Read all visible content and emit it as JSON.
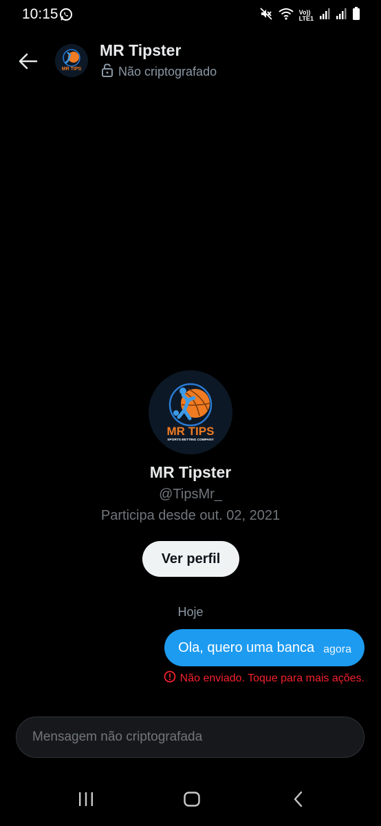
{
  "status_bar": {
    "time": "10:15",
    "volte_top": "Vo))",
    "volte_bottom": "LTE1",
    "icons": [
      "whatsapp-icon",
      "mute-icon",
      "wifi-icon",
      "signal-icon",
      "signal-icon",
      "battery-icon"
    ]
  },
  "header": {
    "name": "MR Tipster",
    "encryption_status": "Não criptografado"
  },
  "profile": {
    "name": "MR Tipster",
    "handle": "@TipsMr_",
    "joined": "Participa desde out. 02, 2021",
    "view_profile_label": "Ver perfil",
    "logo_text": "MR TIPS",
    "logo_subtext": "SPORTS BETTING COMPANY"
  },
  "conversation": {
    "date_separator": "Hoje",
    "messages": [
      {
        "text": "Ola, quero uma banca",
        "time": "agora",
        "error": "Não enviado. Toque para mais ações."
      }
    ]
  },
  "composer": {
    "placeholder": "Mensagem não criptografada"
  },
  "colors": {
    "background": "#000000",
    "accent": "#1d9bf0",
    "error": "#f4212e",
    "secondary_text": "#71767b",
    "logo_orange": "#f07b22",
    "logo_blue": "#2a7bd1"
  }
}
